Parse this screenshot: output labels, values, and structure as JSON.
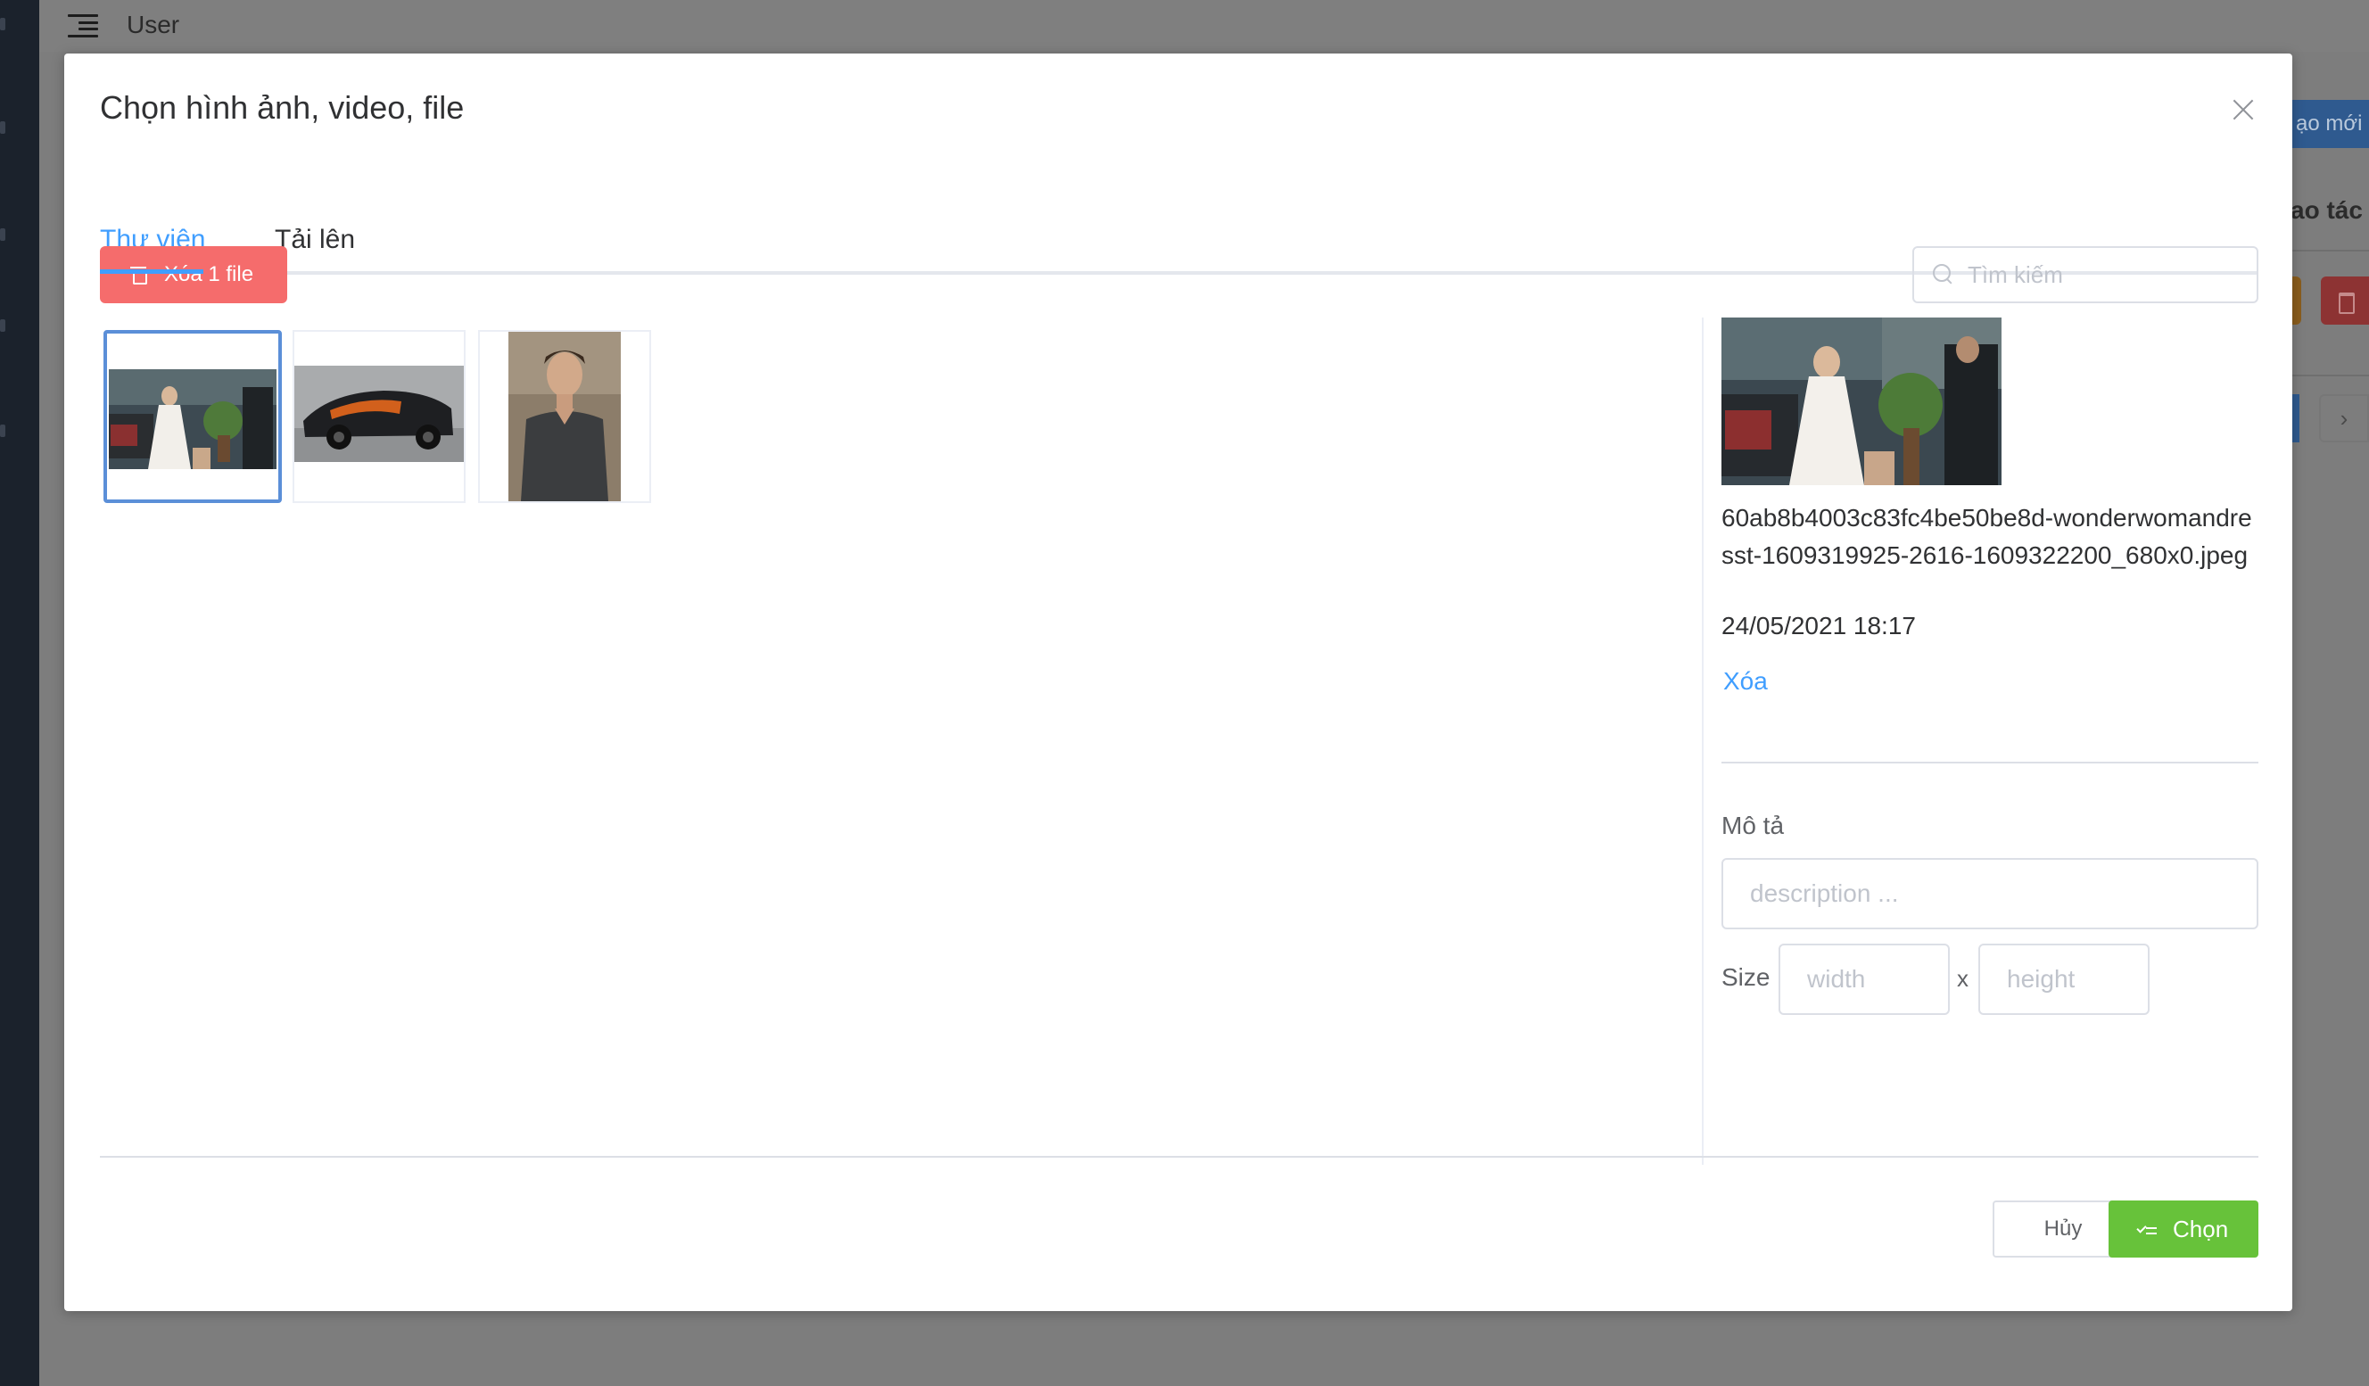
{
  "app": {
    "header_title": "User",
    "bg_new_button": "ạo mới",
    "bg_column_header": "ao tác",
    "bg_next_glyph": "›"
  },
  "modal": {
    "title": "Chọn hình ảnh, video, file",
    "tabs": [
      {
        "label": "Thư viện",
        "active": true
      },
      {
        "label": "Tải lên",
        "active": false
      }
    ],
    "delete_button_label": "Xóa 1 file",
    "search": {
      "placeholder": "Tìm kiếm",
      "value": ""
    },
    "thumbnails": [
      {
        "subject": "woman in white dress by car",
        "selected": true
      },
      {
        "subject": "black and orange sports car",
        "selected": false
      },
      {
        "subject": "man in dark t-shirt portrait",
        "selected": false
      }
    ],
    "detail": {
      "file_name": "60ab8b4003c83fc4be50be8d-wonderwomandresst-1609319925-2616-1609322200_680x0.jpeg",
      "date": "24/05/2021 18:17",
      "delete_link": "Xóa",
      "description_label": "Mô tả",
      "description_placeholder": "description ...",
      "size_label": "Size",
      "width_placeholder": "width",
      "separator": "x",
      "height_placeholder": "height"
    },
    "footer": {
      "cancel_label": "Hủy",
      "choose_label": "Chọn"
    }
  },
  "colors": {
    "primary": "#409eff",
    "danger": "#f56c6c",
    "success": "#67c23a",
    "overlay": "#7d7d7d",
    "sidebar": "#1b222c"
  }
}
